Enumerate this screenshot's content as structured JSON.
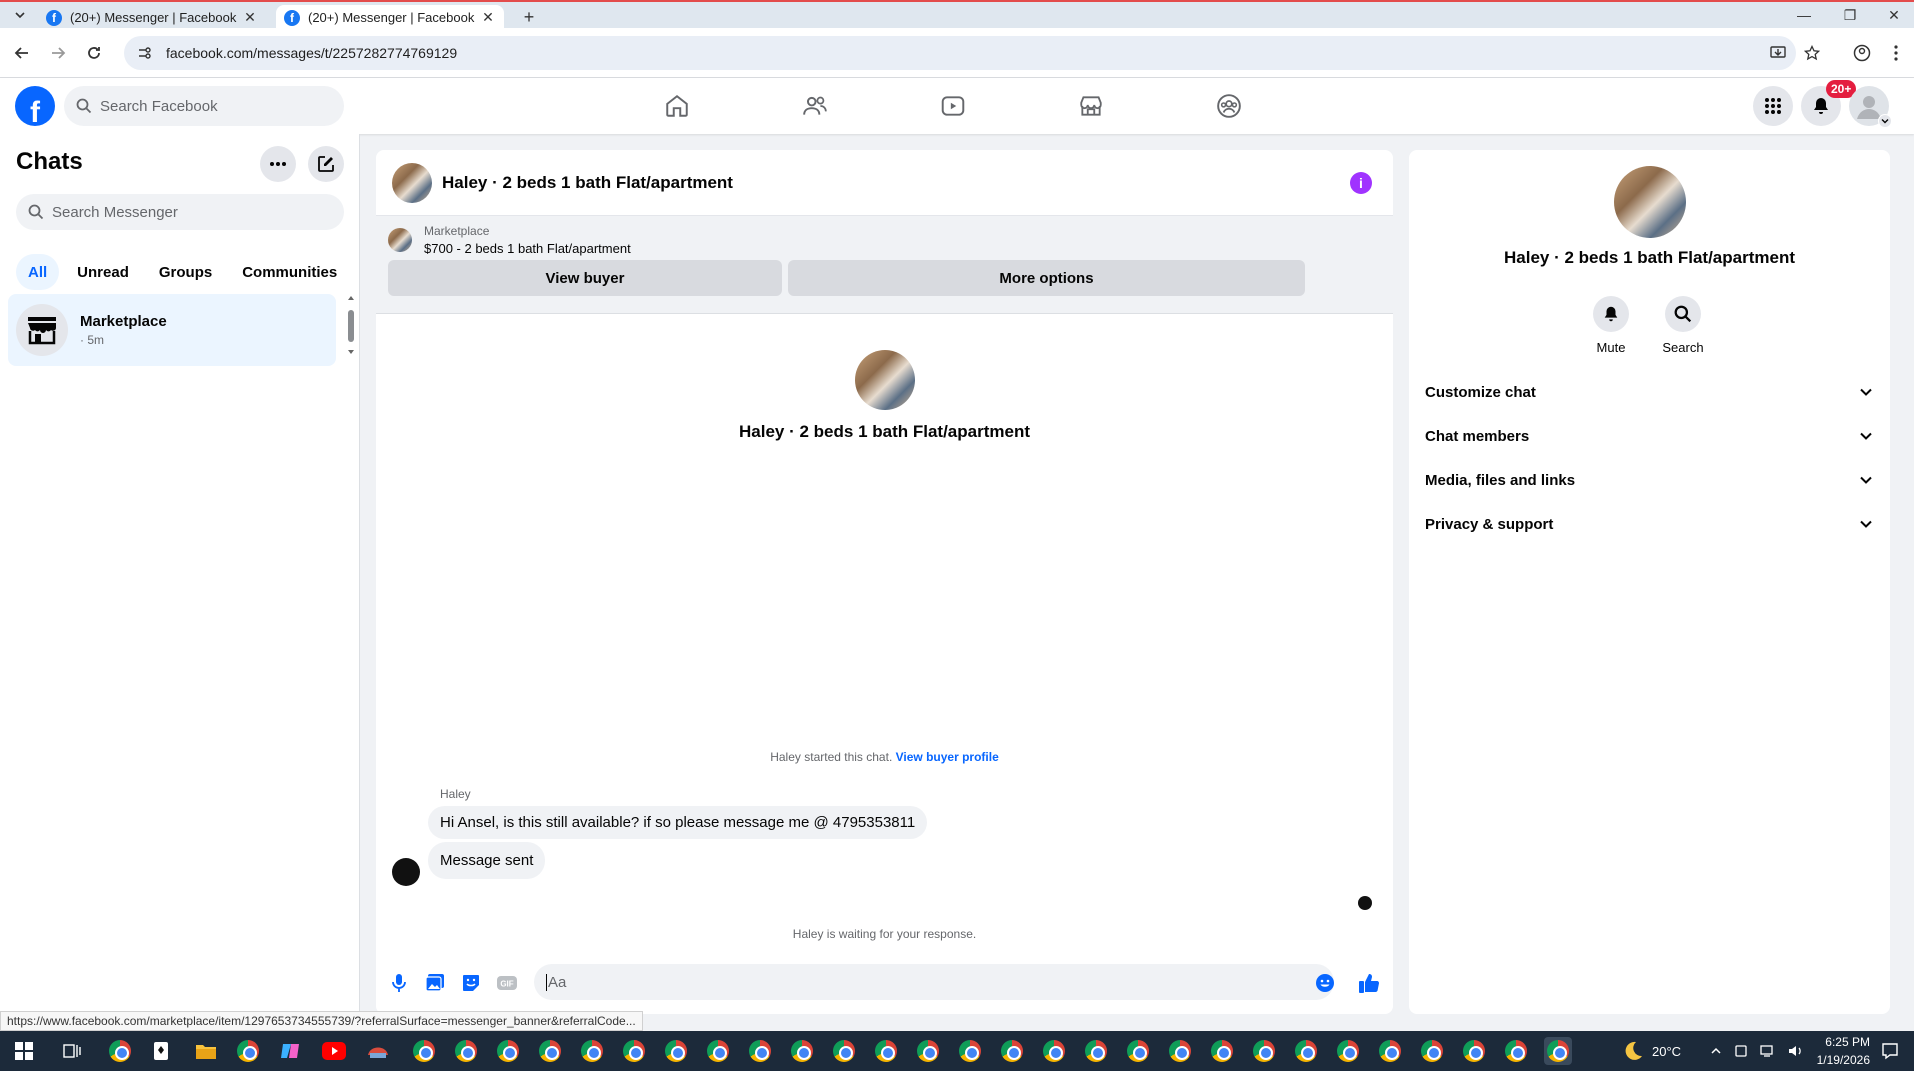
{
  "browser": {
    "tabs": [
      {
        "title": "(20+) Messenger | Facebook",
        "active": false
      },
      {
        "title": "(20+) Messenger | Facebook",
        "active": true
      }
    ],
    "url": "facebook.com/messages/t/2257282774769129",
    "status_url": "https://www.facebook.com/marketplace/item/1297653734555739/?referralSurface=messenger_banner&referralCode..."
  },
  "fb_header": {
    "search_placeholder": "Search Facebook",
    "notification_badge": "20+",
    "nav_icons": [
      "home-icon",
      "friends-icon",
      "video-icon",
      "marketplace-icon",
      "groups-icon"
    ]
  },
  "chats_panel": {
    "title": "Chats",
    "search_placeholder": "Search Messenger",
    "filters": [
      "All",
      "Unread",
      "Groups",
      "Communities"
    ],
    "active_filter": "All",
    "items": [
      {
        "name": "Marketplace",
        "time": "· 5m"
      }
    ]
  },
  "conversation": {
    "title": "Haley · 2 beds 1 bath Flat/apartment",
    "banner": {
      "label": "Marketplace",
      "listing": "$700 - 2 beds 1 bath Flat/apartment",
      "view_buyer": "View buyer",
      "more_options": "More options"
    },
    "intro_name": "Haley · 2 beds 1 bath Flat/apartment",
    "started_text": "Haley started this chat.",
    "started_link": "View buyer profile",
    "sender": "Haley",
    "messages": [
      "Hi Ansel, is this still available? if so please message me @ 4795353811",
      "Message sent"
    ],
    "waiting": "Haley is waiting for your response.",
    "input_placeholder": "Aa",
    "accent_color": "#0866ff"
  },
  "info_panel": {
    "name": "Haley · 2 beds 1 bath Flat/apartment",
    "actions": [
      "Mute",
      "Search"
    ],
    "sections": [
      "Customize chat",
      "Chat members",
      "Media, files and links",
      "Privacy & support"
    ]
  },
  "taskbar": {
    "weather": "20°C",
    "time": "6:25 PM",
    "date": "1/19/2026"
  }
}
